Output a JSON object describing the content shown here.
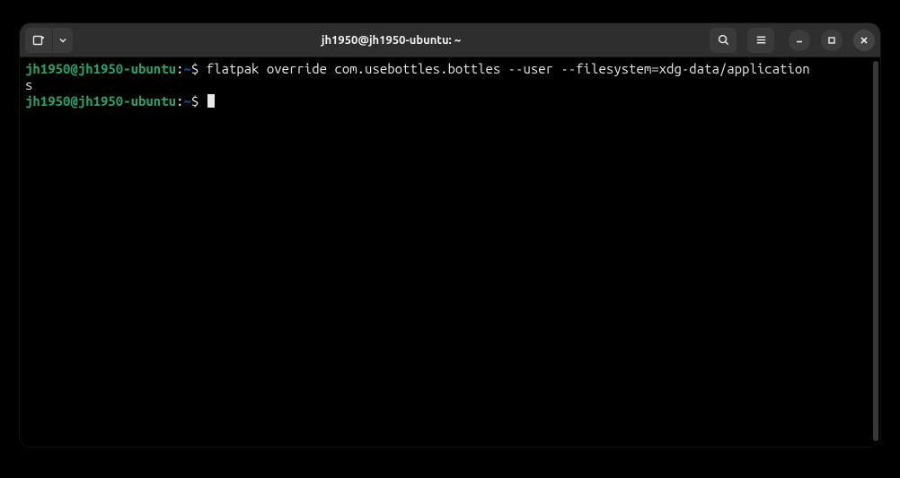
{
  "window": {
    "title": "jh1950@jh1950-ubuntu: ~"
  },
  "prompt": {
    "user_host": "jh1950@jh1950-ubuntu",
    "separator": ":",
    "path": "~",
    "symbol": "$"
  },
  "lines": {
    "cmd1": "flatpak override com.usebottles.bottles --user --filesystem=xdg-data/application",
    "cmd1_wrap": "s"
  },
  "icons": {
    "new_tab": "new-tab-icon",
    "tabs_dropdown": "chevron-down-icon",
    "search": "search-icon",
    "menu": "hamburger-icon",
    "minimize": "minimize-icon",
    "maximize": "maximize-icon",
    "close": "close-icon"
  }
}
